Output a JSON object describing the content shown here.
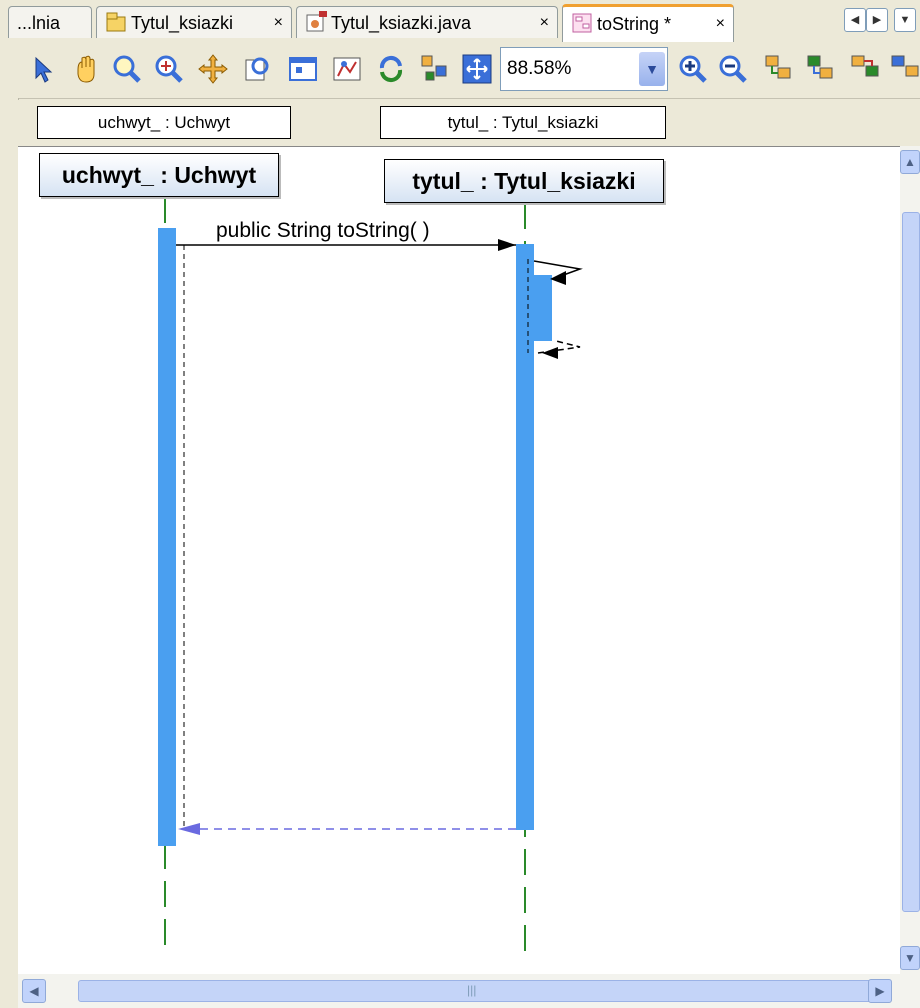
{
  "tabs": [
    {
      "label": "...lnia",
      "closable": false,
      "active": false,
      "icon": null
    },
    {
      "label": "Tytul_ksiazki",
      "closable": true,
      "active": false,
      "icon": "class-diagram-icon"
    },
    {
      "label": "Tytul_ksiazki.java",
      "closable": true,
      "active": false,
      "icon": "java-file-icon"
    },
    {
      "label": "toString *",
      "closable": true,
      "active": true,
      "icon": "sequence-diagram-icon"
    }
  ],
  "tab_close_glyph": "×",
  "toolbar": {
    "zoom_value": "88.58%",
    "tools": [
      "select-icon",
      "pan-hand-icon",
      "zoom-icon",
      "zoom-interactive-icon",
      "move-icon",
      "overview-icon",
      "fit-window-icon",
      "layout-icon",
      "relayout-icon",
      "distribute-icon",
      "fit-to-window-icon"
    ],
    "after_zoom_tools": [
      "zoom-in-icon",
      "zoom-out-icon",
      "expand-icon",
      "collapse-icon",
      "navigate-icon",
      "more-icon"
    ]
  },
  "header_strip": {
    "left_label": "uchwyt_ : Uchwyt",
    "right_label": "tytul_ : Tytul_ksiazki"
  },
  "diagram": {
    "lifelines": [
      {
        "name": "uchwyt_ : Uchwyt"
      },
      {
        "name": "tytul_ : Tytul_ksiazki"
      }
    ],
    "message": "public String  toString( )",
    "colors": {
      "activation": "#4a9ff0",
      "lifeline": "#2a8a2a",
      "return_arrow": "#6a6ae0"
    }
  },
  "scrollbars": {
    "grip": "|||"
  }
}
